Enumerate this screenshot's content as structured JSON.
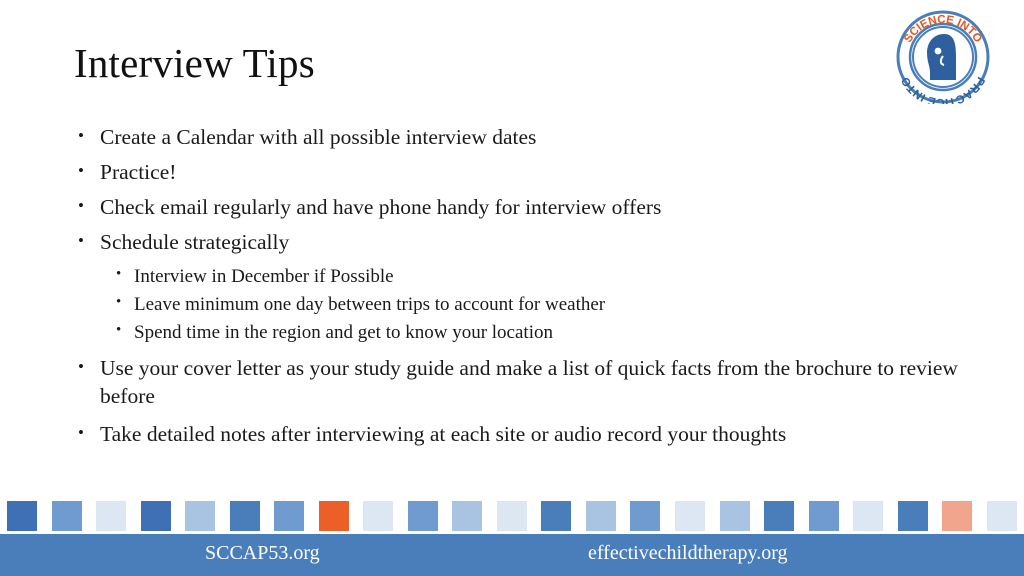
{
  "slide": {
    "title": "Interview Tips",
    "bullets": [
      {
        "level": 1,
        "text": "Create a Calendar with all possible interview dates"
      },
      {
        "level": 1,
        "text": "Practice!"
      },
      {
        "level": 1,
        "text": "Check email regularly and have phone handy for interview offers"
      },
      {
        "level": 1,
        "text": "Schedule strategically"
      },
      {
        "level": 2,
        "text": "Interview in December if Possible"
      },
      {
        "level": 2,
        "text": "Leave minimum one day between trips to account for weather"
      },
      {
        "level": 2,
        "text": "Spend time in the region and get to know your location"
      },
      {
        "level": 1,
        "text": "Use your cover letter as your study guide and make a list of quick facts from the brochure to review before"
      },
      {
        "level": 1,
        "text": "Take detailed notes after interviewing at each site or audio record your thoughts"
      }
    ]
  },
  "logo": {
    "name": "science-into-practice-logo",
    "text_top": "SCIENCE INTO",
    "text_bottom": "PRACTICE INTO",
    "ring_color": "#4a7ebb",
    "accent_color": "#e8561f",
    "face_color": "#2e5f9e"
  },
  "footer": {
    "left_text": "SCCAP53.org",
    "right_text": "effectivechildtherapy.org",
    "bar_color": "#4a7ebb",
    "text_color": "#ffffff"
  },
  "decor": {
    "square_colors": [
      "#3f6fb5",
      "#6f9bd1",
      "#dce7f3",
      "#3f6fb5",
      "#a8c4e2",
      "#4a7ebb",
      "#6f9bd1",
      "#ed5f28",
      "#dce7f3",
      "#6f9bd1",
      "#a8c4e2",
      "#dce7f3",
      "#4a7ebb",
      "#a8c4e2",
      "#6f9bd1",
      "#dce7f3",
      "#a8c4e2",
      "#4a7ebb",
      "#6f9bd1",
      "#dce7f3",
      "#4a7ebb",
      "#f0a58c",
      "#dce7f3"
    ]
  }
}
